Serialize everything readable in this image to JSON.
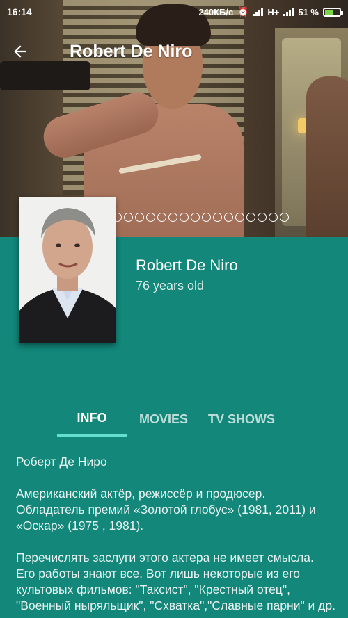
{
  "status_bar": {
    "time": "16:14",
    "network_speed": "240КБ/с",
    "network_type": "H+",
    "battery": "51 %",
    "battery_level": 0.51
  },
  "toolbar": {
    "title": "Robert De Niro",
    "back_icon": "arrow-back-icon"
  },
  "gallery": {
    "dot_count": 21,
    "active_index": 0
  },
  "profile": {
    "name": "Robert De Niro",
    "age": "76 years old"
  },
  "tabs": [
    {
      "label": "INFO",
      "active": true
    },
    {
      "label": "MOVIES",
      "active": false
    },
    {
      "label": "TV SHOWS",
      "active": false
    }
  ],
  "content": {
    "heading": "Роберт Де Ниро",
    "paragraph1": "Американский актёр, режиссёр и продюсер. Обладатель премий «Золотой глобус» (1981, 2011) и «Оскар» (1975 , 1981).",
    "paragraph2": "Перечислять заслуги этого актера не имеет смысла. Его работы знают все. Вот лишь некоторые из его культовых фильмов: \"Таксист\", \"Крестный отец\", \"Военный ныряльщик\", \"Схватка\",\"Славные парни\" и др."
  },
  "colors": {
    "primary": "#12877a",
    "tab_indicator": "#65e0cf"
  }
}
